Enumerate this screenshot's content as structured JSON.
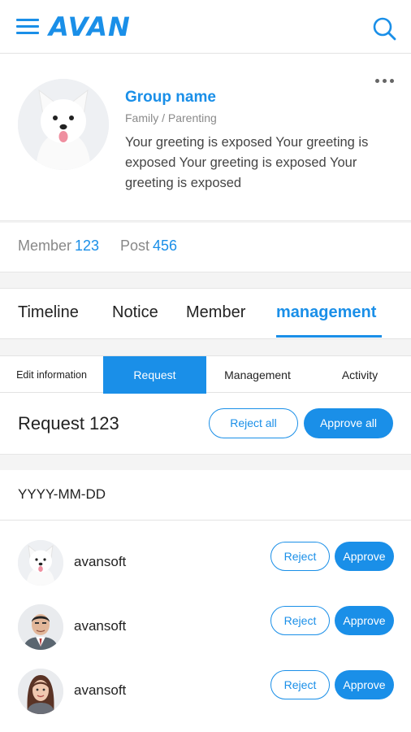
{
  "header": {
    "logo": "AVAN",
    "menu_icon": "hamburger-menu-icon",
    "search_icon": "search-icon",
    "accent": "#1a8fe8"
  },
  "profile": {
    "group_name": "Group name",
    "category": "Family / Parenting",
    "greeting": "Your greeting is exposed Your greeting is exposed Your greeting is exposed Your greeting is exposed",
    "avatar_icon": "dog-avatar",
    "more_icon": "more-dots-icon"
  },
  "stats": {
    "member_label": "Member",
    "member_count": "123",
    "post_label": "Post",
    "post_count": "456"
  },
  "tabs": [
    {
      "label": "Timeline",
      "active": false
    },
    {
      "label": "Notice",
      "active": false
    },
    {
      "label": "Member",
      "active": false
    },
    {
      "label": "management",
      "active": true
    }
  ],
  "subtabs": [
    {
      "label": "Edit information",
      "active": false
    },
    {
      "label": "Request",
      "active": true
    },
    {
      "label": "Management",
      "active": false
    },
    {
      "label": "Activity",
      "active": false
    }
  ],
  "request": {
    "title": "Request 123",
    "reject_all": "Reject all",
    "approve_all": "Approve all"
  },
  "date": "YYYY-MM-DD",
  "requests": [
    {
      "name": "avansoft",
      "avatar": "dog-avatar",
      "reject": "Reject",
      "approve": "Approve"
    },
    {
      "name": "avansoft",
      "avatar": "man-avatar",
      "reject": "Reject",
      "approve": "Approve"
    },
    {
      "name": "avansoft",
      "avatar": "woman-avatar",
      "reject": "Reject",
      "approve": "Approve"
    }
  ]
}
